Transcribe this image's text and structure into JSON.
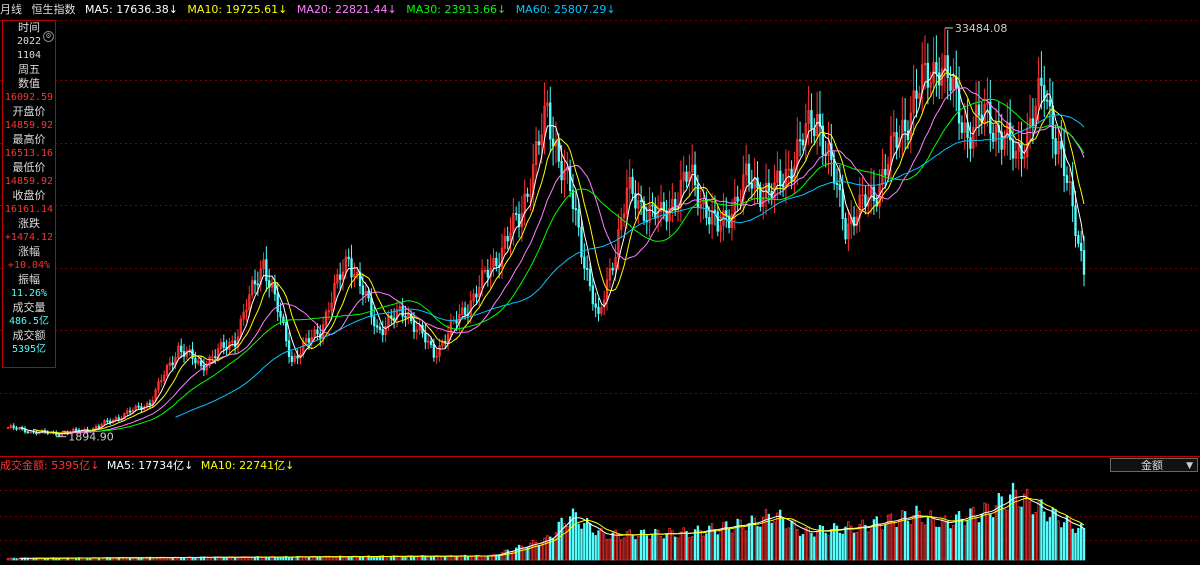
{
  "topbar": {
    "period": "月线",
    "index_name": "恒生指数",
    "ma5": "MA5: 17636.38↓",
    "ma10": "MA10: 19725.61↓",
    "ma20": "MA20: 22821.44↓",
    "ma30": "MA30: 23913.66↓",
    "ma60": "MA60: 25807.29↓"
  },
  "info_panel": {
    "time_label": "时间",
    "year": "2022",
    "date": "1104",
    "weekday": "周五",
    "value_label": "数值",
    "value": "16092.59",
    "open_label": "开盘价",
    "open": "14859.92",
    "high_label": "最高价",
    "high": "16513.16",
    "low_label": "最低价",
    "low": "14859.92",
    "close_label": "收盘价",
    "close": "16161.14",
    "change_label": "涨跌",
    "change": "+1474.12",
    "pct_label": "涨幅",
    "pct": "+10.04%",
    "amp_label": "振幅",
    "amp": "11.26%",
    "vol_label": "成交量",
    "vol": "486.5亿",
    "amount_label": "成交额",
    "amount": "5395亿"
  },
  "volume_bar": {
    "amount": "成交金额: 5395亿↓",
    "ma5": "MA5: 17734亿↓",
    "ma10": "MA10: 22741亿↓",
    "select_value": "金额"
  },
  "colors": {
    "up": "#ff3232",
    "down": "#54ffff",
    "ma5": "#ffffff",
    "ma10": "#ffff00",
    "ma20": "#ff80ff",
    "ma30": "#00ff00",
    "ma60": "#00c8ff",
    "grid": "#7a0000"
  },
  "chart_data": {
    "type": "candlestick",
    "title": "恒生指数 月线",
    "annotations": {
      "max_label": "33484.08",
      "min_label": "1894.90"
    },
    "anchors": [
      [
        0,
        3000
      ],
      [
        10,
        2600
      ],
      [
        18,
        2500
      ],
      [
        30,
        2900
      ],
      [
        50,
        5000
      ],
      [
        60,
        9500
      ],
      [
        68,
        8000
      ],
      [
        80,
        10200
      ],
      [
        90,
        16600
      ],
      [
        100,
        8500
      ],
      [
        110,
        11000
      ],
      [
        120,
        17000
      ],
      [
        130,
        11000
      ],
      [
        140,
        12500
      ],
      [
        150,
        9000
      ],
      [
        165,
        14000
      ],
      [
        180,
        20000
      ],
      [
        190,
        28500
      ],
      [
        198,
        22000
      ],
      [
        208,
        11500
      ],
      [
        218,
        22000
      ],
      [
        230,
        20000
      ],
      [
        240,
        23500
      ],
      [
        250,
        19000
      ],
      [
        260,
        23000
      ],
      [
        270,
        22000
      ],
      [
        285,
        28500
      ],
      [
        295,
        19500
      ],
      [
        305,
        22000
      ],
      [
        320,
        30000
      ],
      [
        328,
        33000
      ],
      [
        338,
        27000
      ],
      [
        345,
        28500
      ],
      [
        355,
        25000
      ],
      [
        365,
        30500
      ],
      [
        370,
        26000
      ],
      [
        379,
        16100
      ]
    ],
    "volume_anchors": [
      [
        0,
        0.02
      ],
      [
        170,
        0.05
      ],
      [
        190,
        0.25
      ],
      [
        198,
        0.55
      ],
      [
        210,
        0.3
      ],
      [
        240,
        0.33
      ],
      [
        262,
        0.45
      ],
      [
        270,
        0.55
      ],
      [
        280,
        0.34
      ],
      [
        300,
        0.4
      ],
      [
        320,
        0.55
      ],
      [
        330,
        0.45
      ],
      [
        345,
        0.6
      ],
      [
        355,
        0.8
      ],
      [
        365,
        0.6
      ],
      [
        379,
        0.35
      ]
    ]
  }
}
